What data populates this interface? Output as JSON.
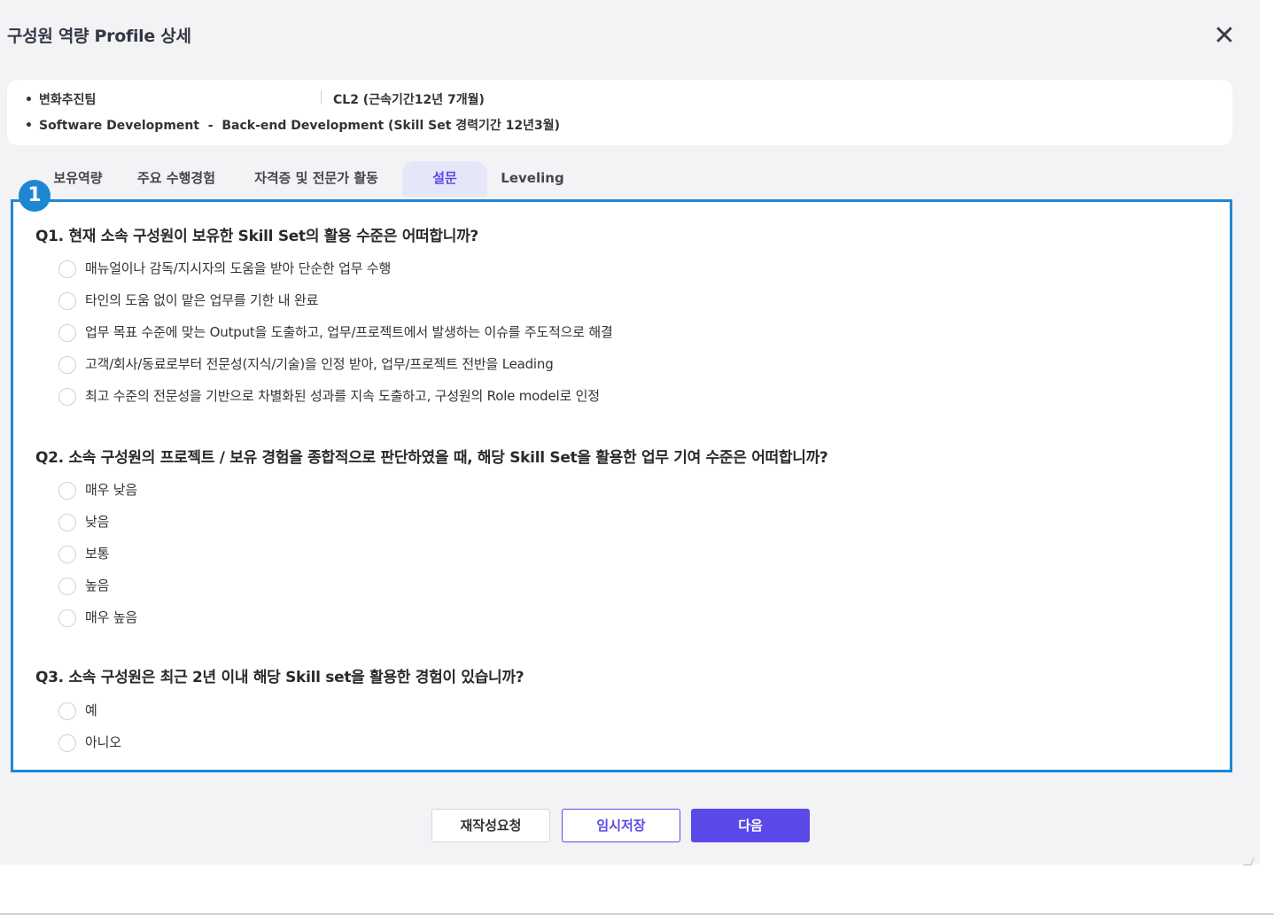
{
  "modal": {
    "title": "구성원 역량 Profile 상세",
    "close_icon": "close-icon"
  },
  "info": {
    "department": "변화추진팀",
    "career_level": "CL2 (근속기간12년 7개월)",
    "skill_line": "Software Development  -  Back-end Development (Skill Set 경력기간 12년3월)"
  },
  "tabs": [
    {
      "label": "보유역량",
      "active": false
    },
    {
      "label": "주요 수행경험",
      "active": false
    },
    {
      "label": "자격증 및 전문가 활동",
      "active": false
    },
    {
      "label": "설문",
      "active": true
    },
    {
      "label": "Leveling",
      "active": false
    }
  ],
  "annotation_badge": "1",
  "questions": [
    {
      "text": "Q1. 현재 소속 구성원이 보유한 Skill Set의 활용 수준은 어떠합니까?",
      "options": [
        "매뉴얼이나 감독/지시자의 도움을 받아 단순한 업무 수행",
        "타인의 도움 없이 맡은 업무를 기한 내 완료",
        "업무 목표 수준에 맞는 Output을 도출하고, 업무/프로젝트에서 발생하는 이슈를 주도적으로 해결",
        "고객/회사/동료로부터 전문성(지식/기술)을 인정 받아, 업무/프로젝트 전반을 Leading",
        "최고 수준의 전문성을 기반으로 차별화된 성과를 지속 도출하고, 구성원의 Role model로 인정"
      ]
    },
    {
      "text": "Q2. 소속 구성원의 프로젝트 / 보유 경험을 종합적으로 판단하였을 때, 해당 Skill Set을 활용한 업무 기여 수준은 어떠합니까?",
      "options": [
        "매우 낮음",
        "낮음",
        "보통",
        "높음",
        "매우 높음"
      ]
    },
    {
      "text": "Q3. 소속 구성원은 최근 2년 이내 해당 Skill set을 활용한 경험이 있습니까?",
      "options": [
        "예",
        "아니오"
      ]
    }
  ],
  "buttons": {
    "rewrite": "재작성요청",
    "save": "임시저장",
    "next": "다음"
  },
  "colors": {
    "accent": "#5a49e8",
    "highlight_border": "#1d87d4",
    "modal_bg": "#f3f3f6"
  }
}
